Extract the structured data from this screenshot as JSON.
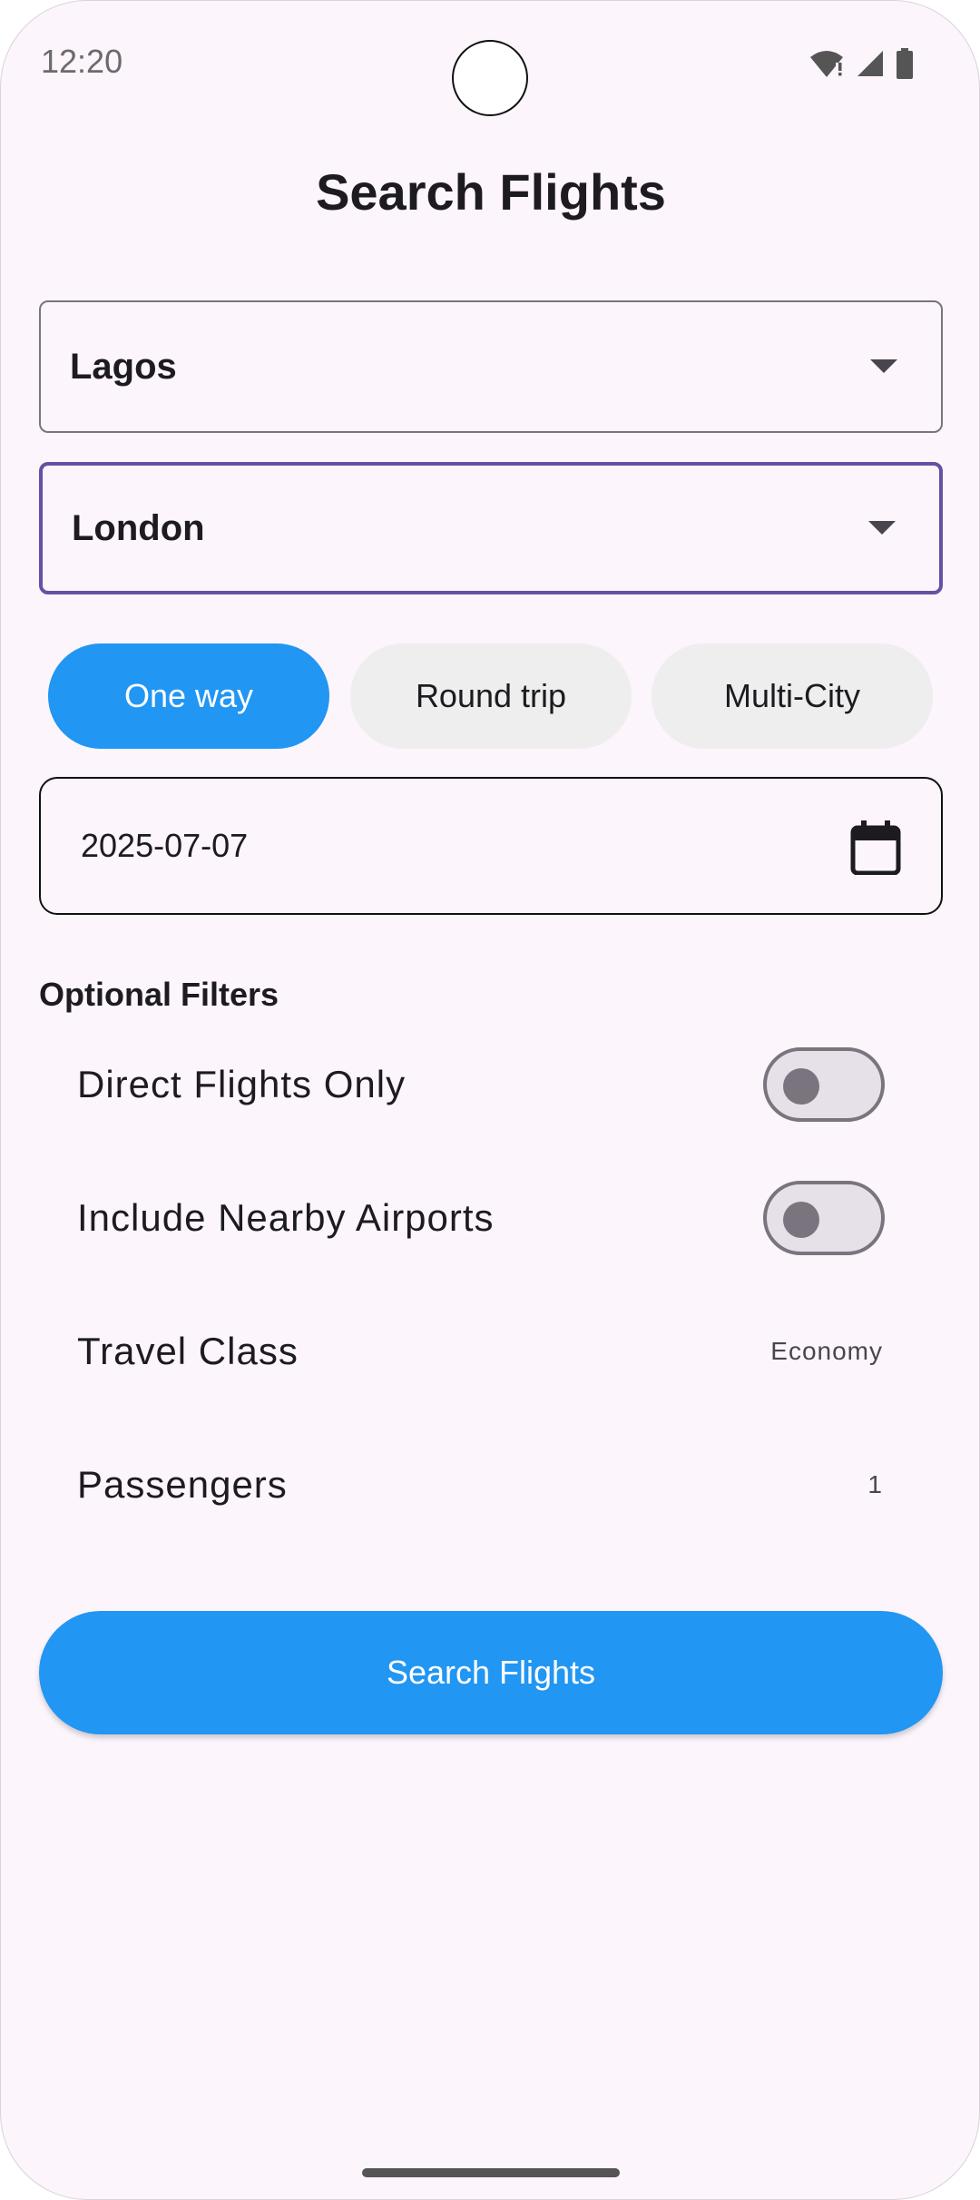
{
  "status_bar": {
    "time": "12:20",
    "icons": [
      "wifi-alert-icon",
      "cellular-signal-icon",
      "battery-icon"
    ]
  },
  "page_title": "Search Flights",
  "origin": {
    "value": "Lagos",
    "icon": "chevron-down-icon"
  },
  "destination": {
    "value": "London",
    "icon": "chevron-down-icon"
  },
  "trip_types": [
    {
      "label": "One way",
      "selected": true
    },
    {
      "label": "Round trip",
      "selected": false
    },
    {
      "label": "Multi-City",
      "selected": false
    }
  ],
  "date": {
    "value": "2025-07-07",
    "icon": "calendar-icon"
  },
  "filters": {
    "section_title": "Optional Filters",
    "direct_flights": {
      "label": "Direct Flights Only",
      "enabled": false
    },
    "nearby_airports": {
      "label": "Include Nearby Airports",
      "enabled": false
    },
    "travel_class": {
      "label": "Travel Class",
      "value": "Economy"
    },
    "passengers": {
      "label": "Passengers",
      "value": "1"
    }
  },
  "search_button": {
    "label": "Search Flights"
  },
  "colors": {
    "accent": "#2196f3",
    "focus_border": "#6750a4",
    "background": "#fcf5fc",
    "chip_unselected": "#eeeeee"
  }
}
